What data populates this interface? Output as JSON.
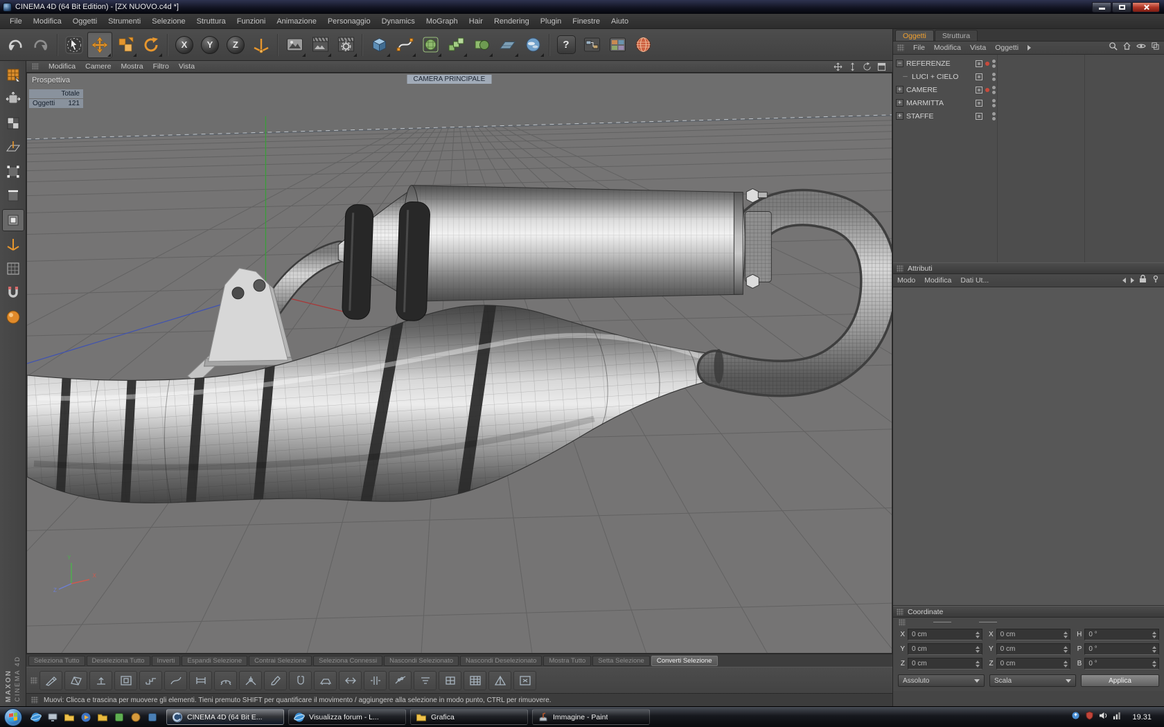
{
  "window": {
    "title": "CINEMA 4D (64 Bit Edition) - [ZX NUOVO.c4d *]",
    "controls": [
      "minimize-icon",
      "maximize-icon",
      "close-icon"
    ]
  },
  "menu_bar": {
    "items": [
      "File",
      "Modifica",
      "Oggetti",
      "Strumenti",
      "Selezione",
      "Struttura",
      "Funzioni",
      "Animazione",
      "Personaggio",
      "Dynamics",
      "MoGraph",
      "Hair",
      "Rendering",
      "Plugin",
      "Finestre",
      "Aiuto"
    ]
  },
  "toolbar": {
    "axis_lock": [
      "X",
      "Y",
      "Z"
    ],
    "help_glyph": "?",
    "icons": [
      "undo",
      "redo",
      "live-selection",
      "move",
      "scale",
      "rotate",
      "lock-x",
      "lock-y",
      "lock-z",
      "coordinate-system",
      "render-view",
      "render-picture-viewer",
      "render-settings",
      "add-cube",
      "spline-pen",
      "subdivision-surface",
      "array",
      "boole",
      "floor",
      "sky",
      "help",
      "xpresso",
      "content-browser",
      "net-render-globe"
    ],
    "active_tool": "move"
  },
  "left_toolbar": {
    "icons": [
      "make-editable",
      "model-mode",
      "texture-mode",
      "workplane-mode",
      "points-mode",
      "edges-mode",
      "polygons-mode",
      "axis-mode",
      "uv-mode",
      "snap-mode",
      "viewport-render"
    ],
    "active": "polygons-mode"
  },
  "viewport": {
    "menu": [
      "Modifica",
      "Camere",
      "Mostra",
      "Filtro",
      "Vista"
    ],
    "controls": [
      "pan",
      "zoom",
      "orbit",
      "maximize"
    ],
    "camera_label": "CAMERA PRINCIPALE",
    "perspective_label": "Prospettiva",
    "stats": {
      "total_label": "Totale",
      "object_label": "Oggetti",
      "object_count": "121"
    },
    "axis_gizmo": {
      "x": "X",
      "y": "Y",
      "z": "Z"
    },
    "bg_color": "#6e6e6e",
    "scene_description": "wireframe-shaded scooter exhaust: expansion chamber, silencer with rubber rings, mounting bracket, u-bend pipe"
  },
  "object_manager": {
    "tabs": [
      {
        "label": "Oggetti"
      },
      {
        "label": "Struttura"
      }
    ],
    "menu": [
      "File",
      "Modifica",
      "Vista",
      "Oggetti"
    ],
    "objects": [
      {
        "label": "REFERENZE",
        "expand": "−",
        "marker": "#c84a3c"
      },
      {
        "label": "LUCI + CIELO",
        "expand": "─",
        "marker": ""
      },
      {
        "label": "CAMERE",
        "expand": "+",
        "marker": "#c84a3c"
      },
      {
        "label": "MARMITTA",
        "expand": "+",
        "marker": ""
      },
      {
        "label": "STAFFE",
        "expand": "+",
        "marker": ""
      }
    ]
  },
  "attributes": {
    "title": "Attributi",
    "menu": [
      "Modo",
      "Modifica",
      "Dati Ut..."
    ]
  },
  "coordinates": {
    "title": "Coordinate",
    "grid": [
      {
        "pl": "X",
        "pv": "0 cm",
        "sl": "X",
        "sv": "0 cm",
        "rl": "H",
        "rv": "0 °"
      },
      {
        "pl": "Y",
        "pv": "0 cm",
        "sl": "Y",
        "sv": "0 cm",
        "rl": "P",
        "rv": "0 °"
      },
      {
        "pl": "Z",
        "pv": "0 cm",
        "sl": "Z",
        "sv": "0 cm",
        "rl": "B",
        "rv": "0 °"
      }
    ],
    "mode": "Assoluto",
    "scale": "Scala",
    "apply": "Applica"
  },
  "selection_bar": {
    "buttons": [
      {
        "label": "Seleziona Tutto",
        "enabled": "false"
      },
      {
        "label": "Deseleziona Tutto",
        "enabled": "false"
      },
      {
        "label": "Inverti",
        "enabled": "false"
      },
      {
        "label": "Espandi Selezione",
        "enabled": "false"
      },
      {
        "label": "Contrai Selezione",
        "enabled": "false"
      },
      {
        "label": "Seleziona Connessi",
        "enabled": "false"
      },
      {
        "label": "Nascondi Selezionato",
        "enabled": "false"
      },
      {
        "label": "Nascondi Deselezionato",
        "enabled": "false"
      },
      {
        "label": "Mostra Tutto",
        "enabled": "false"
      },
      {
        "label": "Setta Selezione",
        "enabled": "false"
      },
      {
        "label": "Converti Selezione",
        "enabled": "true"
      }
    ]
  },
  "modeling_bar": {
    "icons": [
      "knife",
      "bevel",
      "extrude",
      "inner-extrude",
      "matrix-extrude",
      "smooth-shift",
      "bridge",
      "stitch-and-sew",
      "weld",
      "brush",
      "magnet",
      "iron",
      "slide",
      "split",
      "disconnect",
      "melt",
      "optimize",
      "subdivide",
      "triangulate",
      "close-polygon-hole"
    ]
  },
  "status_bar": {
    "text": "Muovi: Clicca e trascina per muovere gli elementi. Tieni premuto SHIFT per quantificare il movimento / aggiungere alla selezione in modo punto, CTRL per rimuovere."
  },
  "taskbar": {
    "quick_launch": [
      "internet-explorer",
      "show-desktop",
      "windows-explorer",
      "media-player",
      "folder",
      "app-green",
      "app-amber",
      "app-blue"
    ],
    "tasks": [
      {
        "label": "CINEMA 4D (64 Bit E...",
        "icon": "cinema4d",
        "active": "true"
      },
      {
        "label": "Visualizza forum - L...",
        "icon": "internet-explorer",
        "active": "false"
      },
      {
        "label": "Grafica",
        "icon": "folder",
        "active": "false"
      },
      {
        "label": "Immagine - Paint",
        "icon": "paint",
        "active": "false"
      }
    ],
    "tray_icons": [
      "update",
      "security",
      "volume",
      "network"
    ],
    "clock": "19.31"
  },
  "branding": {
    "maxon": "MAXON",
    "cinema": "CINEMA 4D"
  },
  "colors": {
    "accent_orange": "#e6962e",
    "tab_active_text": "#f0a030",
    "marker_red": "#c84a3c",
    "viewport_bg": "#6e6e6e",
    "camera_label_bg": "#aab6c6"
  }
}
